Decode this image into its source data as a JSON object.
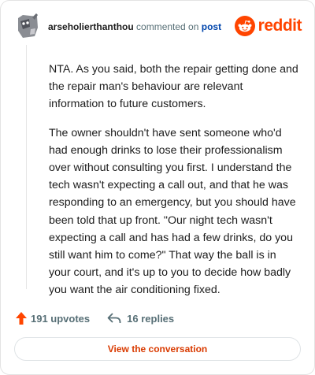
{
  "header": {
    "username": "arseholierthanthou",
    "action_text": "commented on",
    "post_link": "post",
    "brand_text": "reddit",
    "avatar_icon": "snoo-avatar-icon",
    "brand_icon": "reddit-logo-icon"
  },
  "comment": {
    "paragraphs": [
      "NTA. As you said, both the repair getting done and the repair man's behaviour are relevant information to future customers.",
      "The owner shouldn't have sent someone who'd had enough drinks to lose their professionalism over without consulting you first. I understand the tech wasn't expecting a call out, and that he was responding to an emergency, but you should have been told that up front. \"Our night tech wasn't expecting a call and has had a few drinks, do you still want him to come?\" That way the ball is in your court, and it's up to you to decide how badly you want the air conditioning fixed."
    ]
  },
  "stats": {
    "upvotes": "191 upvotes",
    "replies": "16 replies",
    "upvote_icon": "upvote-arrow-icon",
    "reply_icon": "reply-arrow-icon"
  },
  "actions": {
    "view_conversation": "View the conversation"
  },
  "colors": {
    "brand": "#ff4500",
    "link": "#0045ac",
    "muted": "#576f76",
    "button_text": "#d93a00"
  }
}
